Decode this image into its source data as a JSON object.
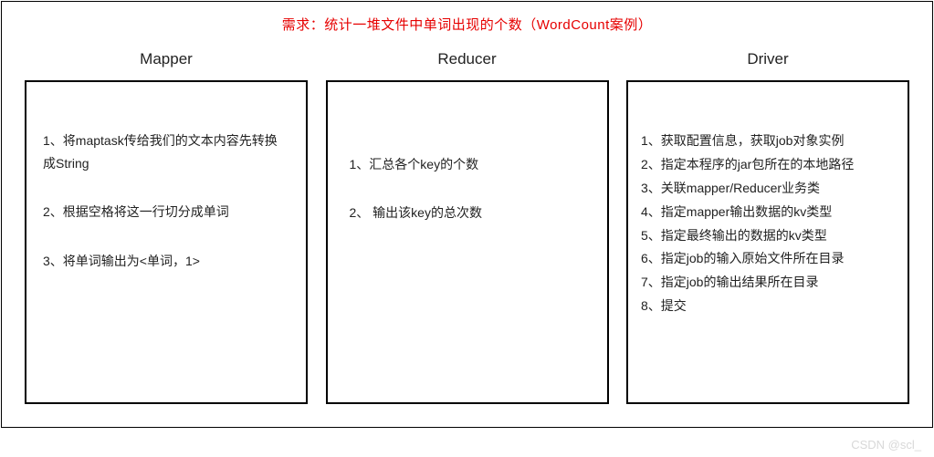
{
  "title": "需求：统计一堆文件中单词出现的个数（WordCount案例）",
  "columns": {
    "mapper": {
      "header": "Mapper",
      "items": [
        "1、将maptask传给我们的文本内容先转换成String",
        "2、根据空格将这一行切分成单词",
        "3、将单词输出为<单词，1>"
      ]
    },
    "reducer": {
      "header": "Reducer",
      "items": [
        "1、汇总各个key的个数",
        "2、 输出该key的总次数"
      ]
    },
    "driver": {
      "header": "Driver",
      "items": [
        "1、获取配置信息，获取job对象实例",
        "2、指定本程序的jar包所在的本地路径",
        "3、关联mapper/Reducer业务类",
        "4、指定mapper输出数据的kv类型",
        "5、指定最终输出的数据的kv类型",
        "6、指定job的输入原始文件所在目录",
        "7、指定job的输出结果所在目录",
        "8、提交"
      ]
    }
  },
  "watermark": "CSDN @scl_"
}
